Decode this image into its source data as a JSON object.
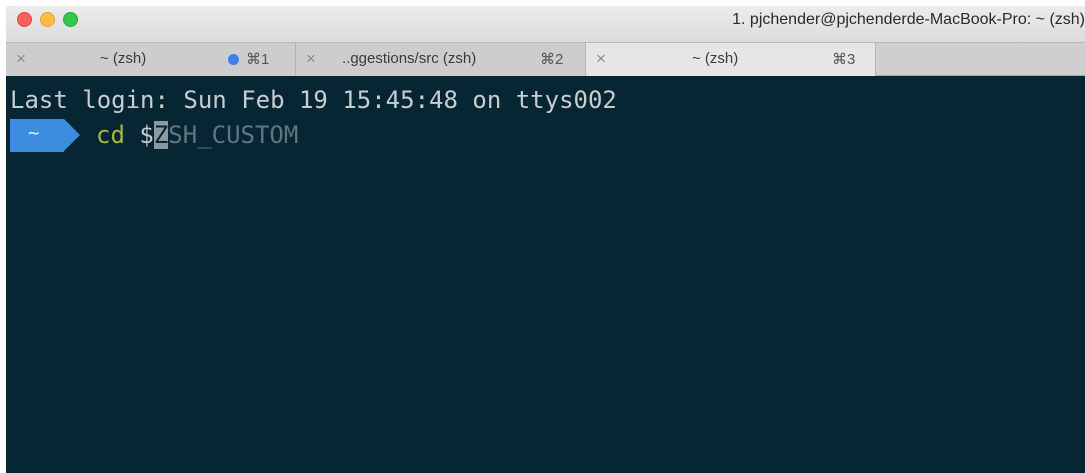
{
  "window": {
    "title": "1. pjchender@pjchenderde-MacBook-Pro: ~ (zsh)"
  },
  "tabs": [
    {
      "label": "~ (zsh)",
      "shortcut": "⌘1",
      "close": "×",
      "has_activity_dot": true
    },
    {
      "label": "..ggestions/src (zsh)",
      "shortcut": "⌘2",
      "close": "×"
    },
    {
      "label": "~ (zsh)",
      "shortcut": "⌘3",
      "close": "×",
      "active": true
    }
  ],
  "terminal": {
    "last_login": "Last login: Sun Feb 19 15:45:48 on ttys002",
    "prompt_dir": "~",
    "command": "cd",
    "dollar": "$",
    "cursor_char": "Z",
    "suggestion": "SH_CUSTOM"
  },
  "colors": {
    "terminal_bg": "#072633",
    "prompt_bg": "#3a8dde",
    "command": "#a4b83c",
    "suggestion": "#5f7680"
  }
}
